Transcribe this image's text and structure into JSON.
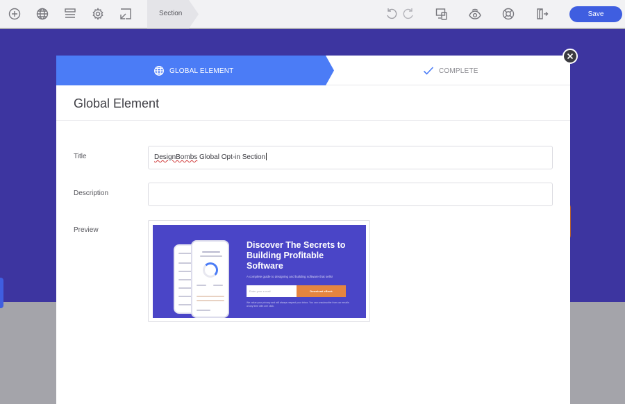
{
  "toolbar": {
    "icons": [
      "add-icon",
      "globe-icon",
      "layers-icon",
      "gear-icon",
      "select-arrow-icon"
    ],
    "section_label": "Section",
    "right_icons": [
      "undo-icon",
      "redo-icon",
      "responsive-icon",
      "preview-eye-icon",
      "help-icon",
      "exit-icon"
    ],
    "save_label": "Save",
    "accent": "#3f5ee0"
  },
  "modal": {
    "steps": [
      {
        "label": "GLOBAL ELEMENT",
        "icon": "globe-icon",
        "active": true
      },
      {
        "label": "COMPLETE",
        "icon": "check-icon",
        "active": false
      }
    ],
    "title": "Global Element",
    "fields": {
      "title_label": "Title",
      "title_value_brand": "DesignBombs",
      "title_value_rest": " Global Opt-in Section",
      "description_label": "Description",
      "description_value": "",
      "preview_label": "Preview"
    },
    "preview": {
      "headline": "Discover The Secrets to Building Profitable Software",
      "subtext": "A complete guide to designing and building software that sells!",
      "email_placeholder": "Enter your e-mail",
      "button_label": "Download eBook",
      "fine_print": "We value your privacy and will always respect your inbox. You can unsubscribe from our emails at any time with one click.",
      "bg_color": "#4a45c7",
      "button_color": "#e5853f"
    },
    "step_active_color": "#4b7cf6"
  }
}
